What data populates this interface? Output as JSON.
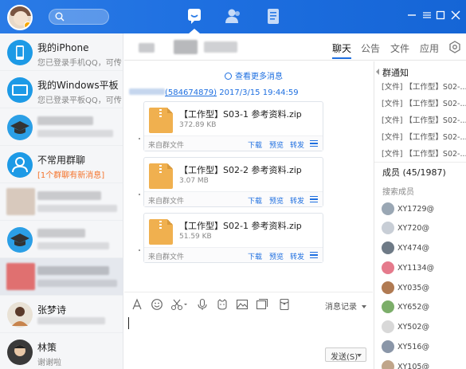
{
  "sidebar": {
    "conversations": [
      {
        "name": "我的iPhone",
        "sub": "您已登录手机QQ，可传"
      },
      {
        "name": "我的Windows平板",
        "sub": "您已登录平板QQ，可传"
      },
      {
        "name": "",
        "sub": ""
      },
      {
        "name": "不常用群聊",
        "sub": "[1个群聊有新消息]"
      },
      {
        "name": "",
        "sub": ""
      },
      {
        "name": "",
        "sub": ""
      },
      {
        "name": "",
        "sub": ""
      },
      {
        "name": "张梦诗",
        "sub": ""
      },
      {
        "name": "林策",
        "sub": "谢谢啦"
      }
    ]
  },
  "header": {
    "tabs": [
      "聊天",
      "公告",
      "文件",
      "应用"
    ]
  },
  "chat": {
    "more_messages": "查看更多消息",
    "sender_id": "(584674879)",
    "timestamp": "2017/3/15 19:44:59",
    "files": [
      {
        "name": "【工作型】S03-1 参考资料.zip",
        "size": "372.89 KB",
        "source": "来自群文件",
        "download": "下载",
        "preview": "预览",
        "forward": "转发"
      },
      {
        "name": "【工作型】S02-2 参考资料.zip",
        "size": "3.07 MB",
        "source": "来自群文件",
        "download": "下载",
        "preview": "预览",
        "forward": "转发"
      },
      {
        "name": "【工作型】S02-1 参考资料.zip",
        "size": "51.59 KB",
        "source": "来自群文件",
        "download": "下载",
        "preview": "预览",
        "forward": "转发"
      }
    ]
  },
  "composer": {
    "history_label": "消息记录",
    "send_label": "发送(S)"
  },
  "right_panel": {
    "notice_title": "群通知",
    "notices": [
      "[文件] 【工作型】S02-...",
      "[文件] 【工作型】S02-...",
      "[文件] 【工作型】S02-...",
      "[文件] 【工作型】S02-...",
      "[文件] 【工作型】S02-..."
    ],
    "members_title": "成员 (45/1987)",
    "search_member": "搜索成员",
    "members": [
      "XY1729@",
      "XY720@",
      "XY474@",
      "XY1134@",
      "XY035@",
      "XY652@",
      "XY502@",
      "XY516@",
      "XY105@"
    ]
  },
  "colors": {
    "accent": "#1e6fe0",
    "warning": "#f5742c",
    "file_icon": "#f0b04f"
  }
}
